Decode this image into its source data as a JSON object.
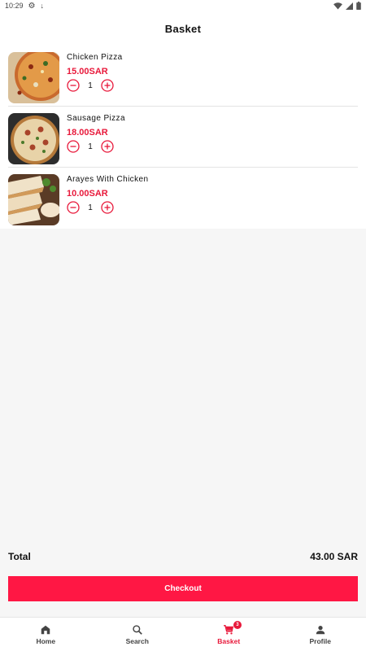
{
  "status_bar": {
    "time": "10:29"
  },
  "header": {
    "title": "Basket"
  },
  "basket": {
    "items": [
      {
        "name": "Chicken Pizza",
        "price": "15.00SAR",
        "quantity": "1"
      },
      {
        "name": "Sausage Pizza",
        "price": "18.00SAR",
        "quantity": "1"
      },
      {
        "name": "Arayes With Chicken",
        "price": "10.00SAR",
        "quantity": "1"
      }
    ]
  },
  "summary": {
    "total_label": "Total",
    "total_value": "43.00 SAR",
    "checkout_label": "Checkout"
  },
  "nav": {
    "items": [
      {
        "label": "Home",
        "icon": "home-icon"
      },
      {
        "label": "Search",
        "icon": "search-icon"
      },
      {
        "label": "Basket",
        "icon": "cart-icon",
        "badge": "3"
      },
      {
        "label": "Profile",
        "icon": "person-icon"
      }
    ],
    "active": "Basket"
  },
  "colors": {
    "accent": "#ff1744",
    "price": "#e8193b",
    "background": "#f6f6f6"
  }
}
